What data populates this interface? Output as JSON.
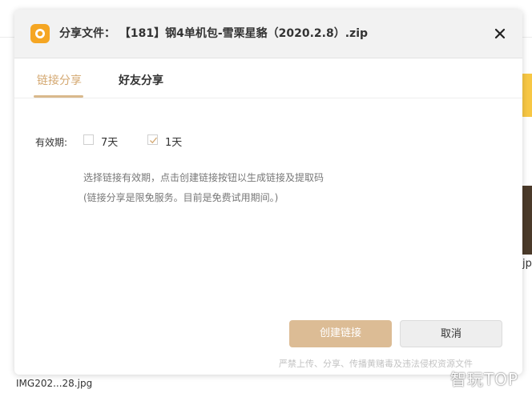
{
  "background": {
    "partial_text": "jp",
    "filename_fragment": "IMG202...28.jpg",
    "watermark": "智玩TOP"
  },
  "dialog": {
    "title_prefix": "分享文件：",
    "file_name": "【181】钢4单机包-雪栗星貉（2020.2.8）.zip",
    "logo_icon": "baidu-netdisk-logo",
    "close_icon": "close-icon",
    "tabs": [
      {
        "label": "链接分享",
        "active": true
      },
      {
        "label": "好友分享",
        "active": false
      }
    ],
    "validity": {
      "label": "有效期:",
      "options": [
        {
          "label": "7天",
          "checked": false
        },
        {
          "label": "1天",
          "checked": true
        }
      ]
    },
    "hint_primary": "选择链接有效期，点击创建链接按钮以生成链接及提取码",
    "hint_secondary": "(链接分享是限免服务。目前是免费试用期间。)",
    "buttons": {
      "create": "创建链接",
      "cancel": "取消"
    },
    "footer_notice": "严禁上传、分享、传播黄赌毒及违法侵权资源文件"
  },
  "colors": {
    "accent": "#d4a871",
    "primary_button": "#dcbc95",
    "logo": "#f5a623"
  }
}
